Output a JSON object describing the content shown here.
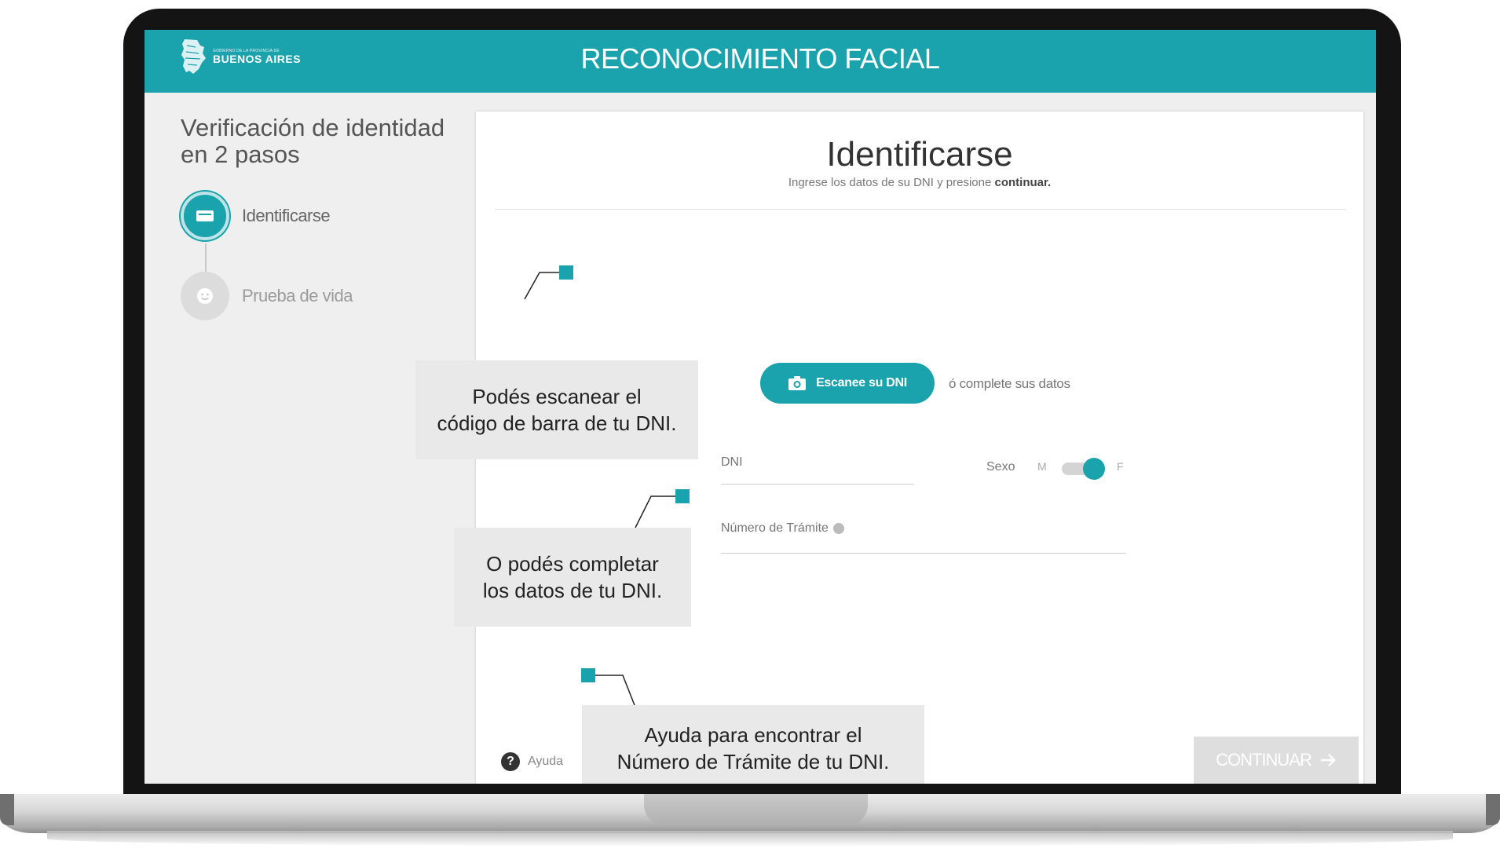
{
  "header": {
    "logo_small": "GOBIERNO DE LA PROVINCIA DE",
    "logo_big": "BUENOS AIRES",
    "title": "RECONOCIMIENTO FACIAL"
  },
  "sidebar": {
    "title": "Verificación de identidad en 2 pasos",
    "steps": [
      {
        "label": "Identificarse",
        "icon": "id-card-icon",
        "state": "active"
      },
      {
        "label": "Prueba de vida",
        "icon": "face-icon",
        "state": "pending"
      }
    ]
  },
  "form": {
    "title": "Identificarse",
    "subtitle_pre": "Ingrese los datos de su DNI y presione",
    "subtitle_bold": "continuar.",
    "scan_button": "Escanee su DNI",
    "scan_alt": "ó complete sus datos",
    "dni_label": "DNI",
    "sexo_label": "Sexo",
    "sexo_options": [
      "M",
      "F"
    ],
    "sexo_selected": "F",
    "tramite_label": "Número de Trámite",
    "help_label": "Ayuda",
    "continue_button": "CONTINUAR"
  },
  "annotations": [
    {
      "text_line1": "Podés escanear el",
      "text_line2": "código de barra de tu DNI."
    },
    {
      "text_line1": "O  podés completar",
      "text_line2": "los datos de tu DNI."
    },
    {
      "text_line1": "Ayuda para encontrar el",
      "text_line2": "Número de Trámite de tu DNI."
    }
  ],
  "colors": {
    "accent": "#1aa2ad",
    "callout_bg": "#e9e9e9",
    "laptop_bezel": "#141414"
  }
}
